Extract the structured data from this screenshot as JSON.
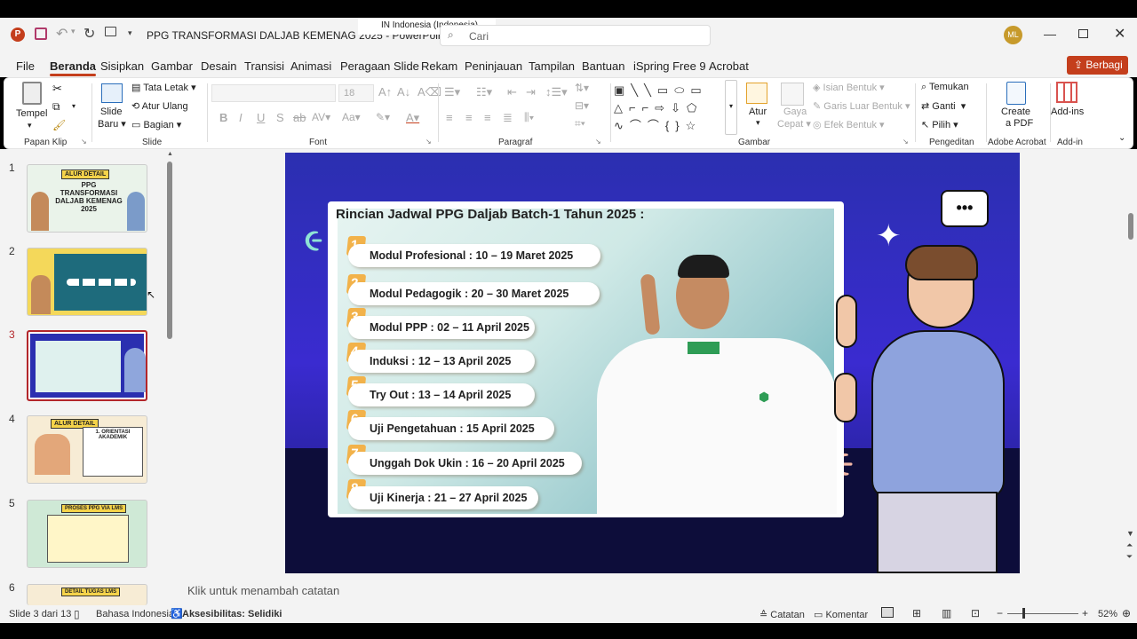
{
  "app": {
    "title": "PPG TRANSFORMASI DALJAB KEMENAG 2025",
    "app_name": "PowerPoint",
    "title_sep": "-",
    "search_placeholder": "Cari",
    "input_indicator": "IN  Indonesia (Indonesia)",
    "user_initials": "ML"
  },
  "menu": [
    "File",
    "Beranda",
    "Sisipkan",
    "Gambar",
    "Desain",
    "Transisi",
    "Animasi",
    "Peragaan Slide",
    "Rekam",
    "Peninjauan",
    "Tampilan",
    "Bantuan",
    "iSpring Free 9",
    "Acrobat"
  ],
  "share_label": "Berbagi",
  "ribbon": {
    "clipboard": {
      "paste": "Tempel",
      "group": "Papan Klip"
    },
    "slides": {
      "new_slide": "Slide",
      "new_slide2": "Baru",
      "layout": "Tata Letak",
      "reset": "Atur Ulang",
      "section": "Bagian",
      "group": "Slide"
    },
    "font": {
      "size": "18",
      "group": "Font"
    },
    "paragraph": {
      "group": "Paragraf"
    },
    "drawing": {
      "arrange": "Atur",
      "styles": "Gaya",
      "styles2": "Cepat",
      "fill": "Isian Bentuk",
      "outline": "Garis Luar Bentuk",
      "effects": "Efek Bentuk",
      "group": "Gambar"
    },
    "editing": {
      "find": "Temukan",
      "replace": "Ganti",
      "select": "Pilih",
      "group": "Pengeditan"
    },
    "acrobat": {
      "create": "Create",
      "create2": "a PDF",
      "group": "Adobe Acrobat"
    },
    "addins": {
      "label": "Add-ins",
      "group": "Add-in"
    }
  },
  "thumbnails": [
    {
      "num": "1",
      "title": "ALUR DETAIL",
      "sub": "PPG TRANSFORMASI DALJAB KEMENAG 2025"
    },
    {
      "num": "2",
      "title": ""
    },
    {
      "num": "3",
      "title": ""
    },
    {
      "num": "4",
      "title": "ALUR DETAIL",
      "sub": "1. ORIENTASI AKADEMIK"
    },
    {
      "num": "5",
      "title": "PROSES PPG VIA LMS"
    },
    {
      "num": "6",
      "title": "DETAIL TUGAS LMS"
    }
  ],
  "slide": {
    "heading": "Rincian Jadwal PPG Daljab Batch-1 Tahun 2025 :",
    "items": [
      {
        "n": "1.",
        "text": "Modul Profesional   : 10 – 19 Maret 2025"
      },
      {
        "n": "2.",
        "text": "Modul Pedagogik : 20 – 30 Maret 2025"
      },
      {
        "n": "3.",
        "text": "Modul PPP : 02 – 11 April 2025"
      },
      {
        "n": "4.",
        "text": "Induksi    : 12 – 13 April 2025"
      },
      {
        "n": "5.",
        "text": "Try Out    :  13 – 14 April 2025"
      },
      {
        "n": "6.",
        "text": "Uji Pengetahuan : 15 April 2025"
      },
      {
        "n": "7.",
        "text": "Unggah Dok Ukin : 16 – 20 April 2025"
      },
      {
        "n": "8.",
        "text": "Uji Kinerja : 21 – 27 April 2025"
      }
    ],
    "speech": "•••"
  },
  "notes_placeholder": "Klik untuk menambah catatan",
  "status": {
    "slide_info": "Slide 3 dari 13",
    "language": "Bahasa Indonesia",
    "accessibility": "Aksesibilitas: Selidiki",
    "notes": "Catatan",
    "comments": "Komentar",
    "zoom": "52%"
  },
  "colors": {
    "accent": "#c43e1c",
    "selected_thumb": "#b3262a",
    "slide_bg": "#2b2fb0"
  }
}
